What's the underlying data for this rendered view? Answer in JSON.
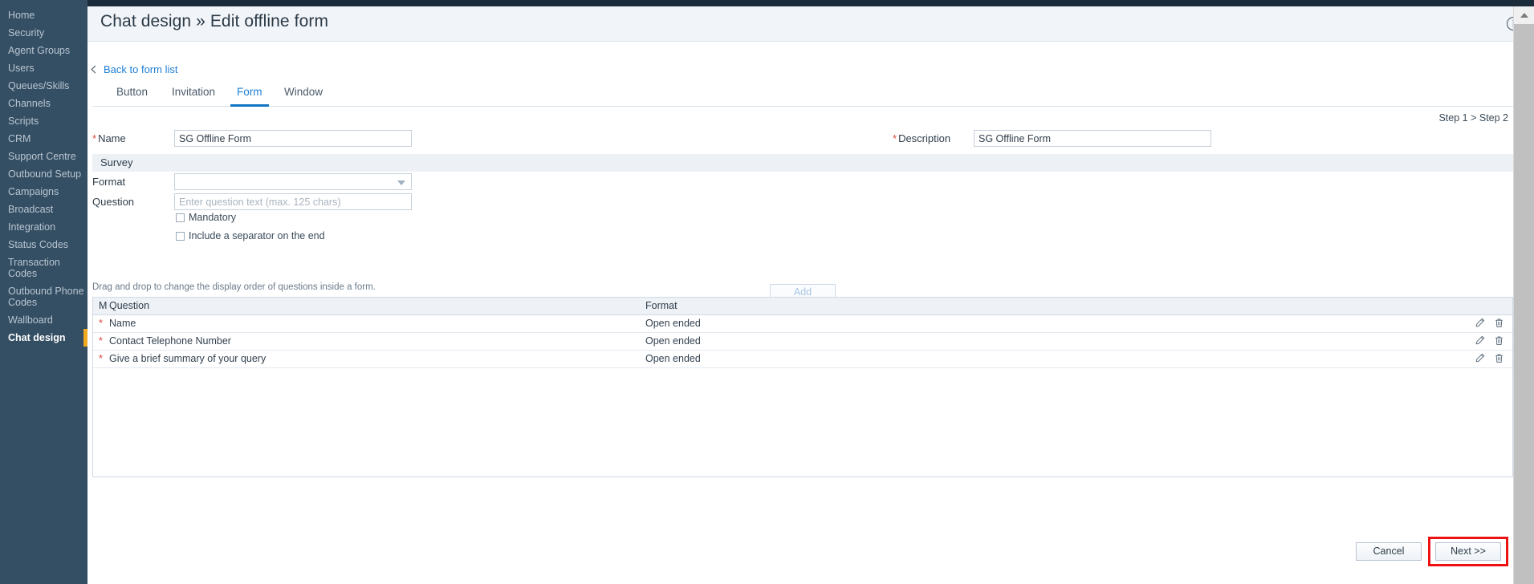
{
  "window": {
    "accent_orange": "#f2a922",
    "sidebar_bg": "#344e63",
    "link_blue": "#1f7fd4",
    "required_red": "#d9453d",
    "highlight_red": "#ee1111"
  },
  "sidebar": {
    "items": [
      {
        "label": "Home",
        "active": false
      },
      {
        "label": "Security",
        "active": false
      },
      {
        "label": "Agent Groups",
        "active": false
      },
      {
        "label": "Users",
        "active": false
      },
      {
        "label": "Queues/Skills",
        "active": false
      },
      {
        "label": "Channels",
        "active": false
      },
      {
        "label": "Scripts",
        "active": false
      },
      {
        "label": "CRM",
        "active": false
      },
      {
        "label": "Support Centre",
        "active": false
      },
      {
        "label": "Outbound Setup",
        "active": false
      },
      {
        "label": "Campaigns",
        "active": false
      },
      {
        "label": "Broadcast",
        "active": false
      },
      {
        "label": "Integration",
        "active": false
      },
      {
        "label": "Status Codes",
        "active": false
      },
      {
        "label": "Transaction Codes",
        "active": false
      },
      {
        "label": "Outbound Phone Codes",
        "active": false
      },
      {
        "label": "Wallboard",
        "active": false
      },
      {
        "label": "Chat design",
        "active": true
      }
    ]
  },
  "header": {
    "title": "Chat design » Edit offline form",
    "info_icon": "info-circle-icon"
  },
  "nav": {
    "back_link": "Back to form list",
    "back_icon": "chevron-left-icon"
  },
  "tabs": [
    {
      "label": "Button",
      "active": false
    },
    {
      "label": "Invitation",
      "active": false
    },
    {
      "label": "Form",
      "active": true
    },
    {
      "label": "Window",
      "active": false
    }
  ],
  "steps": {
    "label": "Step 1 > Step 2"
  },
  "form": {
    "name_label": "Name",
    "name_value": "SG Offline Form",
    "description_label": "Description",
    "description_value": "SG Offline Form",
    "survey_band": "Survey",
    "format_label": "Format",
    "format_value": "",
    "format_caret_icon": "chevron-down-icon",
    "question_label": "Question",
    "question_value": "",
    "question_placeholder": "Enter question text (max. 125 chars)",
    "mandatory_label": "Mandatory",
    "mandatory_checked": false,
    "separator_label": "Include a separator on the end",
    "separator_checked": false,
    "add_label": "Add"
  },
  "table": {
    "hint": "Drag and drop to change the display order of questions inside a form.",
    "columns": {
      "mandatory": "M",
      "question": "Question",
      "format": "Format"
    },
    "rows": [
      {
        "mandatory": "*",
        "question": "Name",
        "format": "Open ended",
        "edit_icon": "pencil-icon",
        "delete_icon": "trash-icon"
      },
      {
        "mandatory": "*",
        "question": "Contact Telephone Number",
        "format": "Open ended",
        "edit_icon": "pencil-icon",
        "delete_icon": "trash-icon"
      },
      {
        "mandatory": "*",
        "question": "Give a brief summary of your query",
        "format": "Open ended",
        "edit_icon": "pencil-icon",
        "delete_icon": "trash-icon"
      }
    ]
  },
  "footer": {
    "cancel_label": "Cancel",
    "next_label": "Next >>"
  }
}
